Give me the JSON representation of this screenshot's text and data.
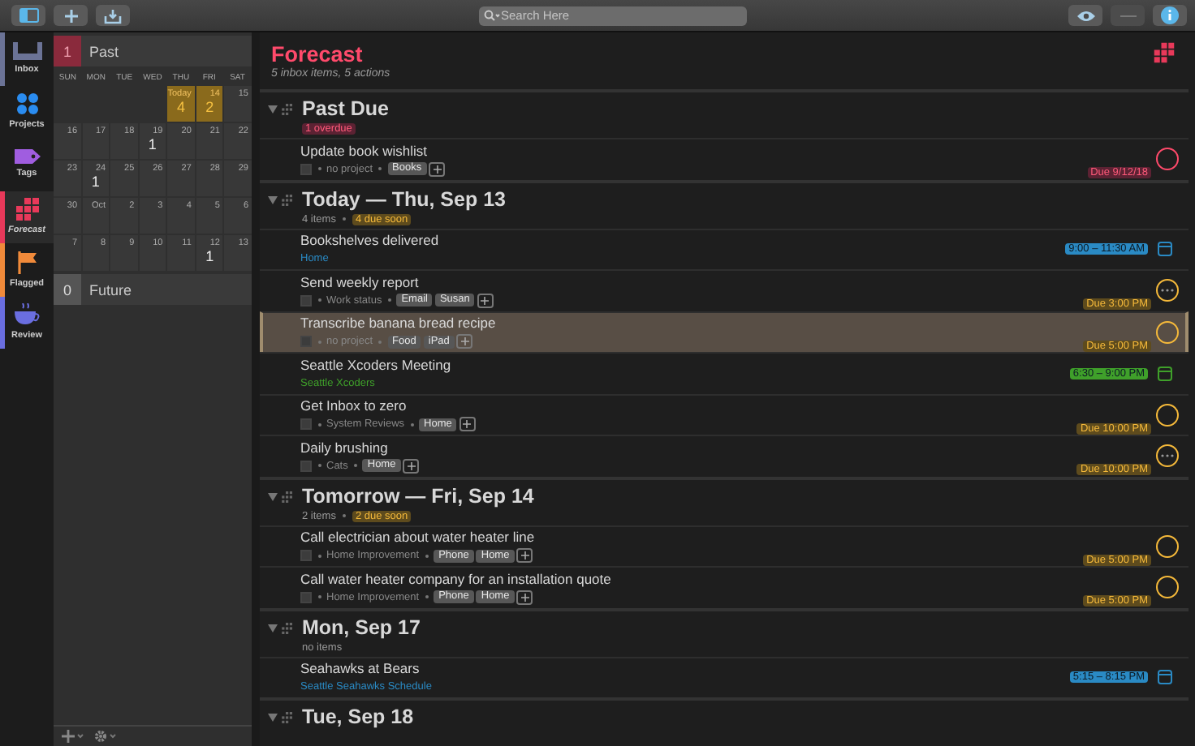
{
  "toolbar": {
    "search": {
      "placeholder": "Search Here"
    }
  },
  "sidebar": {
    "items": [
      {
        "label": "Inbox",
        "kind": "inbox",
        "selected": false,
        "color": "#6b7396"
      },
      {
        "label": "Projects",
        "kind": "projects",
        "selected": false
      },
      {
        "label": "Tags",
        "kind": "tags",
        "selected": false
      },
      {
        "label": "Forecast",
        "kind": "forecast",
        "selected": true,
        "color": "#e8395a"
      },
      {
        "label": "Flagged",
        "kind": "flagged",
        "selected": false,
        "color": "#f08a3a"
      },
      {
        "label": "Review",
        "kind": "review",
        "selected": false,
        "color": "#6a6ee0"
      }
    ]
  },
  "calendar": {
    "past": {
      "count": "1",
      "label": "Past"
    },
    "weekdays": [
      "SUN",
      "MON",
      "TUE",
      "WED",
      "THU",
      "FRI",
      "SAT"
    ],
    "weeks": [
      [
        {
          "label": "Today",
          "count": "4",
          "due_soon": true
        },
        {
          "label": "14",
          "count": "2",
          "due_soon": true
        },
        {
          "label": "15",
          "due_soon": false
        }
      ],
      [
        {
          "label": "16",
          "due_soon": false
        },
        {
          "label": "17",
          "due_soon": false
        },
        {
          "label": "18",
          "due_soon": false
        },
        {
          "label": "19",
          "count": "1",
          "due_soon": false
        },
        {
          "label": "20",
          "due_soon": false
        },
        {
          "label": "21",
          "due_soon": false
        },
        {
          "label": "22",
          "due_soon": false
        }
      ],
      [
        {
          "label": "23",
          "due_soon": false
        },
        {
          "label": "24",
          "count": "1",
          "due_soon": false
        },
        {
          "label": "25",
          "due_soon": false
        },
        {
          "label": "26",
          "due_soon": false
        },
        {
          "label": "27",
          "due_soon": false
        },
        {
          "label": "28",
          "due_soon": false
        },
        {
          "label": "29",
          "due_soon": false
        }
      ],
      [
        {
          "label": "30",
          "due_soon": false
        },
        {
          "label": "Oct",
          "due_soon": false
        },
        {
          "label": "2",
          "due_soon": false
        },
        {
          "label": "3",
          "due_soon": false
        },
        {
          "label": "4",
          "due_soon": false
        },
        {
          "label": "5",
          "due_soon": false
        },
        {
          "label": "6",
          "due_soon": false
        }
      ],
      [
        {
          "label": "7",
          "due_soon": false
        },
        {
          "label": "8",
          "due_soon": false
        },
        {
          "label": "9",
          "due_soon": false
        },
        {
          "label": "10",
          "due_soon": false
        },
        {
          "label": "11",
          "due_soon": false
        },
        {
          "label": "12",
          "count": "1",
          "due_soon": false
        },
        {
          "label": "13",
          "due_soon": false
        }
      ]
    ],
    "future": {
      "count": "0",
      "label": "Future"
    }
  },
  "header": {
    "title": "Forecast",
    "subtitle": "5 inbox items, 5 actions"
  },
  "sections": [
    {
      "title": "Past Due",
      "expanded": true,
      "badge": {
        "text": "1 overdue",
        "kind": "overdue"
      },
      "items": [
        {
          "kind": "task",
          "title": "Update book wishlist",
          "project": "no project",
          "tags": [
            "Books"
          ],
          "due": "Due 9/12/18",
          "overdue": true,
          "repeating": false,
          "selected": false
        }
      ]
    },
    {
      "title": "Today — Thu, Sep 13",
      "expanded": true,
      "count": "4 items",
      "badge": {
        "text": "4 due soon",
        "kind": "soon"
      },
      "items": [
        {
          "kind": "event",
          "title": "Bookshelves delivered",
          "calendar": "Home",
          "time": "9:00 – 11:30 AM",
          "color": "#2a8ac4",
          "selected": false
        },
        {
          "kind": "task",
          "title": "Send weekly report",
          "project": "Work status",
          "tags": [
            "Email",
            "Susan"
          ],
          "due": "Due 3:00 PM",
          "overdue": false,
          "repeating": true,
          "selected": false
        },
        {
          "kind": "task",
          "title": "Transcribe banana bread recipe",
          "project": "no project",
          "tags": [
            "Food",
            "iPad"
          ],
          "due": "Due 5:00 PM",
          "overdue": false,
          "repeating": false,
          "selected": true
        },
        {
          "kind": "event",
          "title": "Seattle Xcoders Meeting",
          "calendar": "Seattle Xcoders",
          "time": "6:30 – 9:00 PM",
          "color": "#3fa02a",
          "selected": false
        },
        {
          "kind": "task",
          "title": "Get Inbox to zero",
          "project": "System Reviews",
          "tags": [
            "Home"
          ],
          "due": "Due 10:00 PM",
          "overdue": false,
          "repeating": false,
          "selected": false
        },
        {
          "kind": "task",
          "title": "Daily brushing",
          "project": "Cats",
          "tags": [
            "Home"
          ],
          "due": "Due 10:00 PM",
          "overdue": false,
          "repeating": true,
          "selected": false
        }
      ]
    },
    {
      "title": "Tomorrow — Fri, Sep 14",
      "expanded": true,
      "count": "2 items",
      "badge": {
        "text": "2 due soon",
        "kind": "soon"
      },
      "items": [
        {
          "kind": "task",
          "title": "Call electrician about water heater line",
          "project": "Home Improvement",
          "tags": [
            "Phone",
            "Home"
          ],
          "due": "Due 5:00 PM",
          "overdue": false,
          "repeating": false,
          "selected": false
        },
        {
          "kind": "task",
          "title": "Call water heater company for an installation quote",
          "project": "Home Improvement",
          "tags": [
            "Phone",
            "Home"
          ],
          "due": "Due 5:00 PM",
          "overdue": false,
          "repeating": false,
          "selected": false
        }
      ]
    },
    {
      "title": "Mon, Sep 17",
      "expanded": true,
      "count": "no items",
      "items": [
        {
          "kind": "event",
          "title": "Seahawks at Bears",
          "calendar": "Seattle Seahawks Schedule",
          "time": "5:15 – 8:15 PM",
          "color": "#2a8ac4",
          "selected": false
        }
      ]
    },
    {
      "title": "Tue, Sep 18",
      "expanded": true
    }
  ]
}
